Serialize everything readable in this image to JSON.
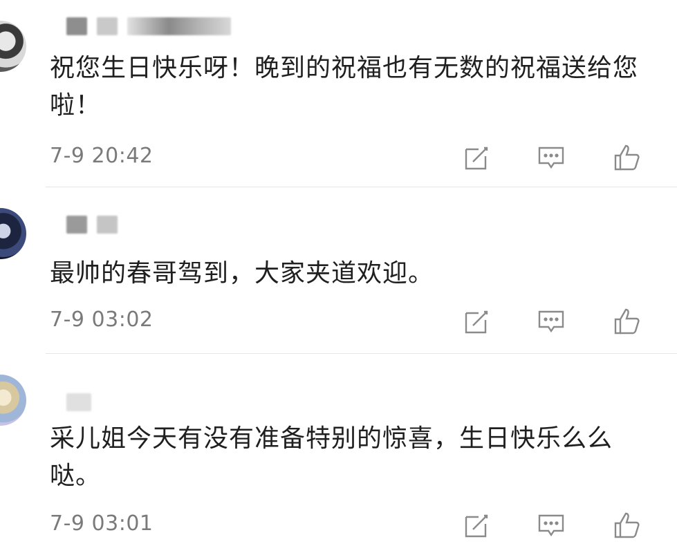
{
  "comments": [
    {
      "text": "祝您生日快乐呀！晚到的祝福也有无数的祝福送给您啦！",
      "time": "7-9 20:42"
    },
    {
      "text": "最帅的春哥驾到，大家夹道欢迎。",
      "time": "7-9 03:02"
    },
    {
      "text": "采儿姐今天有没有准备特别的惊喜，生日快乐么么哒。",
      "time": "7-9 03:01"
    }
  ],
  "icons": {
    "edit": "edit-icon",
    "reply": "comment-bubble-icon",
    "like": "thumbs-up-icon"
  },
  "colors": {
    "text": "#1f1f1f",
    "meta": "#7a7a7a",
    "icon": "#8a8a8a",
    "divider": "#e6e6e6"
  }
}
